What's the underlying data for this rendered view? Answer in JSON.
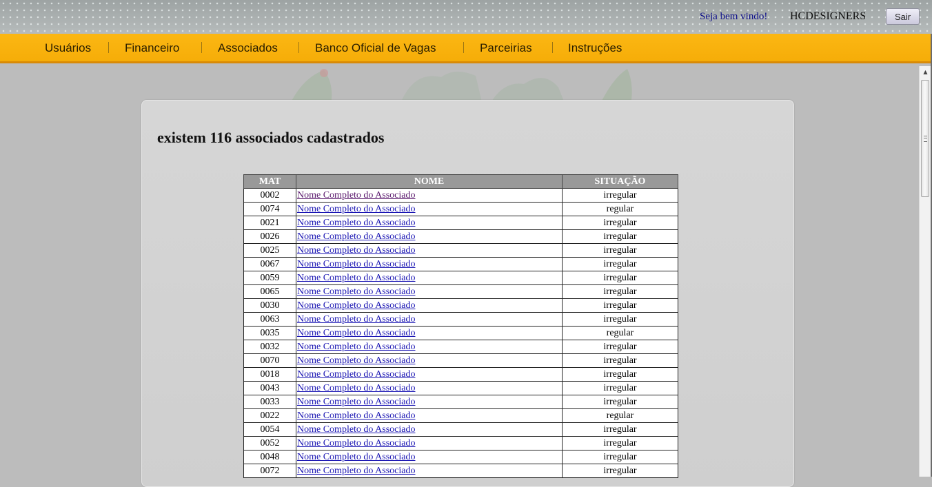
{
  "header": {
    "welcome": "Seja bem vindo!",
    "username": "HCDESIGNERS",
    "logout_label": "Sair"
  },
  "nav": {
    "items": [
      {
        "label": "Usuários"
      },
      {
        "label": "Financeiro"
      },
      {
        "label": "Associados"
      },
      {
        "label": "Banco Oficial de Vagas"
      },
      {
        "label": "Parceirias"
      },
      {
        "label": "Instruções"
      }
    ]
  },
  "main": {
    "heading": "existem 116 associados cadastrados",
    "table": {
      "columns": [
        "MAT",
        "NOME",
        "SITUAÇÃO"
      ],
      "rows": [
        {
          "mat": "0002",
          "nome": "Nome Completo do Associado",
          "situacao": "irregular"
        },
        {
          "mat": "0074",
          "nome": "Nome Completo do Associado",
          "situacao": "regular"
        },
        {
          "mat": "0021",
          "nome": "Nome Completo do Associado",
          "situacao": "irregular"
        },
        {
          "mat": "0026",
          "nome": "Nome Completo do Associado",
          "situacao": "irregular"
        },
        {
          "mat": "0025",
          "nome": "Nome Completo do Associado",
          "situacao": "irregular"
        },
        {
          "mat": "0067",
          "nome": "Nome Completo do Associado",
          "situacao": "irregular"
        },
        {
          "mat": "0059",
          "nome": "Nome Completo do Associado",
          "situacao": "irregular"
        },
        {
          "mat": "0065",
          "nome": "Nome Completo do Associado",
          "situacao": "irregular"
        },
        {
          "mat": "0030",
          "nome": "Nome Completo do Associado",
          "situacao": "irregular"
        },
        {
          "mat": "0063",
          "nome": "Nome Completo do Associado",
          "situacao": "irregular"
        },
        {
          "mat": "0035",
          "nome": "Nome Completo do Associado",
          "situacao": "regular"
        },
        {
          "mat": "0032",
          "nome": "Nome Completo do Associado",
          "situacao": "irregular"
        },
        {
          "mat": "0070",
          "nome": "Nome Completo do Associado",
          "situacao": "irregular"
        },
        {
          "mat": "0018",
          "nome": "Nome Completo do Associado",
          "situacao": "irregular"
        },
        {
          "mat": "0043",
          "nome": "Nome Completo do Associado",
          "situacao": "irregular"
        },
        {
          "mat": "0033",
          "nome": "Nome Completo do Associado",
          "situacao": "irregular"
        },
        {
          "mat": "0022",
          "nome": "Nome Completo do Associado",
          "situacao": "regular"
        },
        {
          "mat": "0054",
          "nome": "Nome Completo do Associado",
          "situacao": "irregular"
        },
        {
          "mat": "0052",
          "nome": "Nome Completo do Associado",
          "situacao": "irregular"
        },
        {
          "mat": "0048",
          "nome": "Nome Completo do Associado",
          "situacao": "irregular"
        },
        {
          "mat": "0072",
          "nome": "Nome Completo do Associado",
          "situacao": "irregular"
        }
      ]
    }
  },
  "colors": {
    "nav_bg": "#fbb713",
    "link": "#1a15b3",
    "link_visited": "#5b1a6e",
    "table_header_bg": "#999999"
  },
  "icons": {
    "scroll_up": "up-arrow-icon",
    "crest": "crest-logo"
  }
}
